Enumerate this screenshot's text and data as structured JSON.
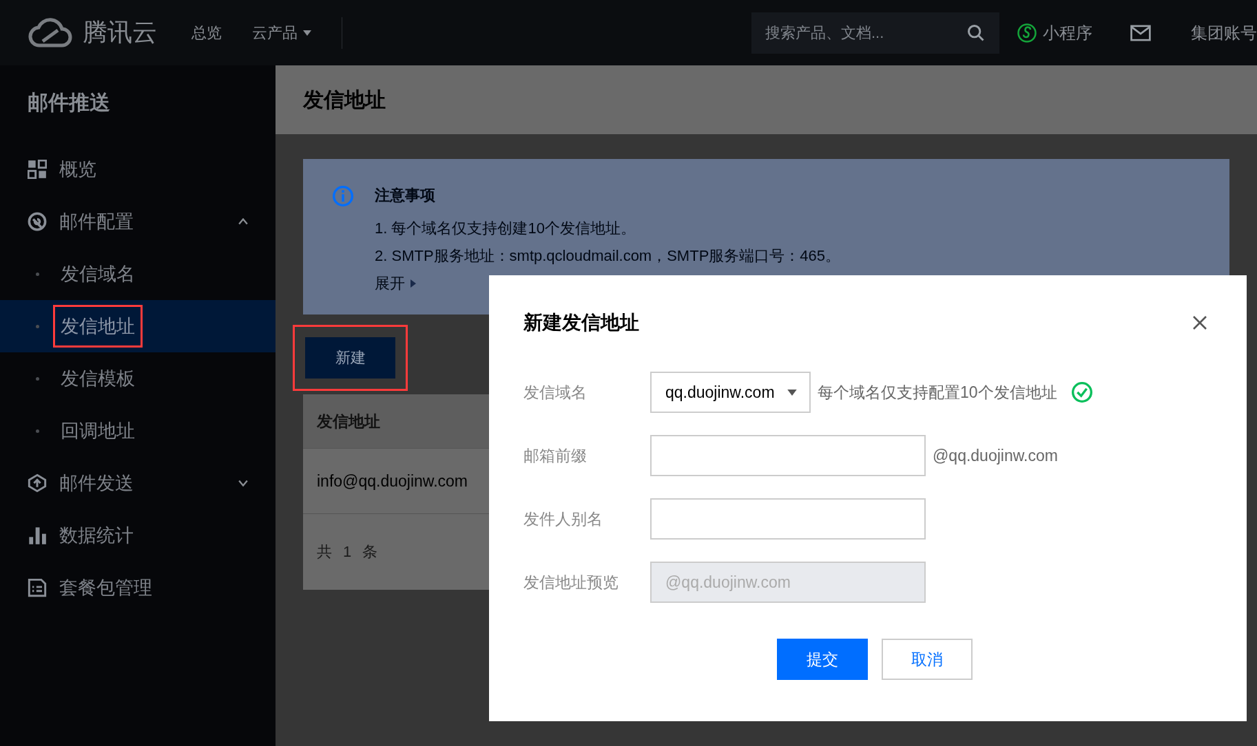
{
  "topbar": {
    "brand": "腾讯云",
    "nav": [
      {
        "label": "总览",
        "dropdown": false
      },
      {
        "label": "云产品",
        "dropdown": true
      }
    ],
    "search": {
      "placeholder": "搜索产品、文档..."
    },
    "links": [
      {
        "kind": "miniprogram",
        "label": "小程序"
      },
      {
        "kind": "mail"
      },
      {
        "kind": "text",
        "label": "集团账号"
      }
    ]
  },
  "sidebar": {
    "title": "邮件推送",
    "items": [
      {
        "kind": "overview",
        "label": "概览"
      },
      {
        "kind": "config",
        "label": "邮件配置",
        "expanded": true,
        "children": [
          {
            "label": "发信域名",
            "selected": false,
            "highlighted": false
          },
          {
            "label": "发信地址",
            "selected": true,
            "highlighted": true
          },
          {
            "label": "发信模板",
            "selected": false,
            "highlighted": false
          },
          {
            "label": "回调地址",
            "selected": false,
            "highlighted": false
          }
        ]
      },
      {
        "kind": "send",
        "label": "邮件发送",
        "expanded": false
      },
      {
        "kind": "stats",
        "label": "数据统计"
      },
      {
        "kind": "package",
        "label": "套餐包管理"
      }
    ]
  },
  "main": {
    "title": "发信地址",
    "notice": {
      "title": "注意事项",
      "lines": [
        "1. 每个域名仅支持创建10个发信地址。",
        "2. SMTP服务地址：smtp.qcloudmail.com，SMTP服务端口号：465。"
      ],
      "toggle": "展开"
    },
    "new_button": {
      "label": "新建",
      "highlighted": true
    },
    "table": {
      "columns": [
        "发信地址"
      ],
      "rows": [
        [
          "info@qq.duojinw.com"
        ]
      ],
      "footer": "共 1 条"
    }
  },
  "dialog": {
    "title": "新建发信地址",
    "fields": [
      {
        "kind": "select",
        "label": "发信域名",
        "value": "qq.duojinw.com",
        "hint": "每个域名仅支持配置10个发信地址",
        "valid": true
      },
      {
        "kind": "input",
        "label": "邮箱前缀",
        "suffix": "@qq.duojinw.com"
      },
      {
        "kind": "input",
        "label": "发件人别名"
      },
      {
        "kind": "preview",
        "label": "发信地址预览",
        "value": "@qq.duojinw.com"
      }
    ],
    "buttons": [
      {
        "label": "提交",
        "primary": true
      },
      {
        "label": "取消",
        "primary": false
      }
    ]
  }
}
